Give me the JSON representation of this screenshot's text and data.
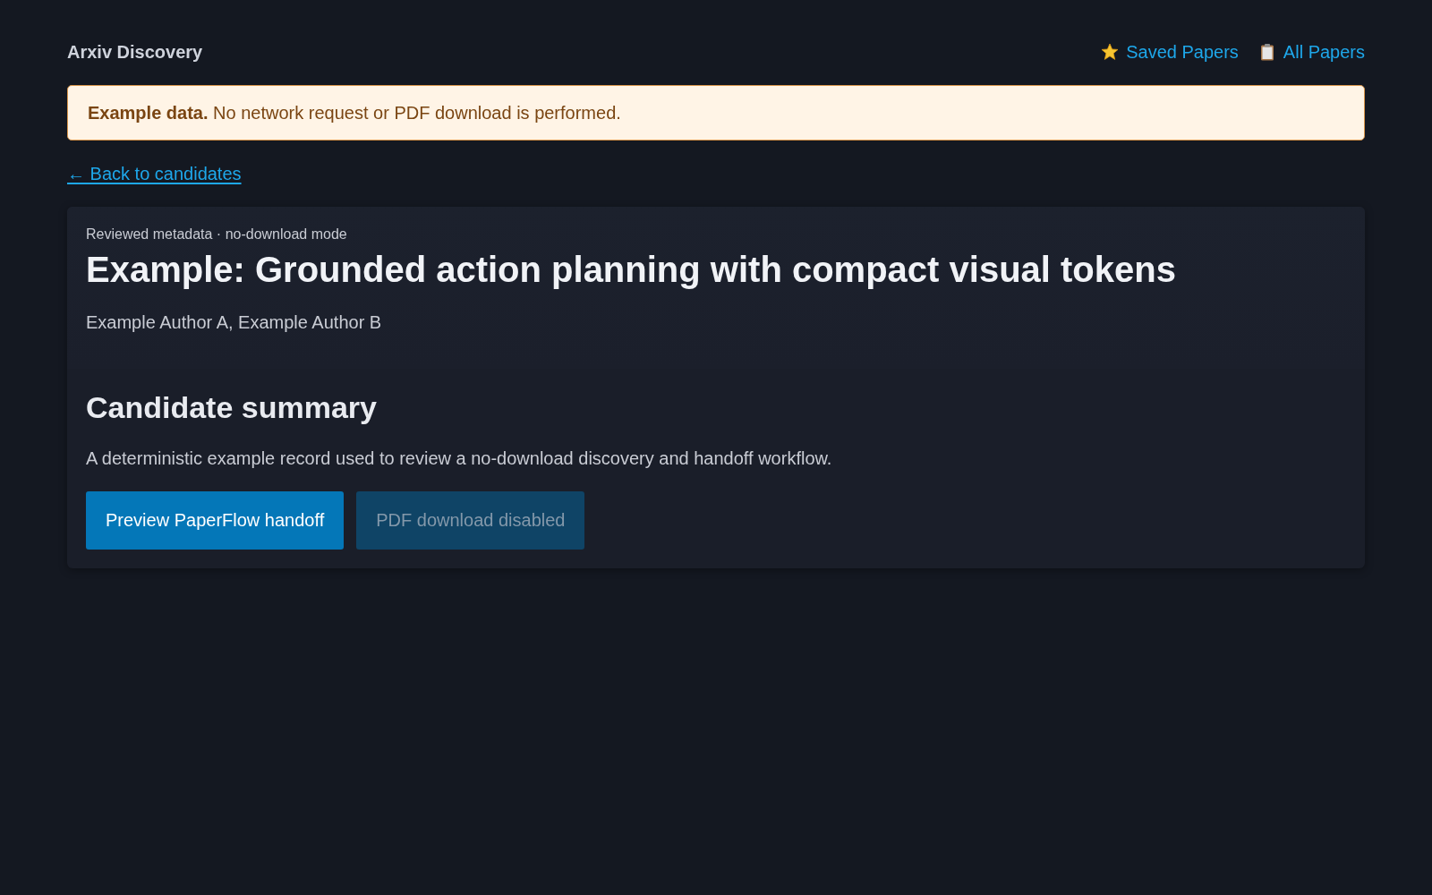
{
  "header": {
    "title": "Arxiv Discovery",
    "nav_links": [
      {
        "kind": "saved",
        "label": "Saved Papers"
      },
      {
        "kind": "all",
        "label": "All Papers"
      }
    ]
  },
  "notice": {
    "text": "**Example data.** No network request or PDF download is performed."
  },
  "back_link": {
    "label": "← Back to candidates"
  },
  "paper": {
    "eyebrow": "Reviewed metadata · no-download mode",
    "title": "Example: Grounded action planning with compact visual tokens",
    "authors": "Example Author A, Example Author B"
  },
  "summary": {
    "heading": "Candidate summary",
    "text": "A deterministic example record used to review a no-download discovery and handoff workflow.",
    "buttons": [
      {
        "label": "Preview PaperFlow handoff",
        "disabled": false
      },
      {
        "label": "PDF download disabled",
        "disabled": true
      }
    ]
  }
}
